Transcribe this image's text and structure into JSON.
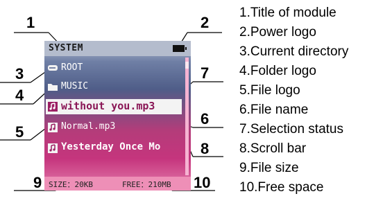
{
  "screen": {
    "title": "SYSTEM",
    "files": [
      {
        "name": "ROOT",
        "kind": "drive"
      },
      {
        "name": "MUSIC",
        "kind": "folder"
      },
      {
        "name": "without you.mp3",
        "kind": "file",
        "selected": true
      },
      {
        "name": "Normal.mp3",
        "kind": "file"
      },
      {
        "name": "Yesterday Once Mo",
        "kind": "file"
      }
    ],
    "size_text": "SIZE：20KB",
    "free_text": "FREE：210MB",
    "colors": {
      "selection": "#f3f3f3",
      "file_icon": "#9b1f63",
      "scroll_track": "#f6b3d2"
    }
  },
  "callouts": [
    "1",
    "2",
    "3",
    "4",
    "5",
    "6",
    "7",
    "8",
    "9",
    "10"
  ],
  "legend": [
    "1.Title of module",
    "2.Power logo",
    "3.Current directory",
    "4.Folder logo",
    "5.File logo",
    "6.File name",
    "7.Selection status",
    "8.Scroll bar",
    "9.File size",
    "10.Free space"
  ]
}
